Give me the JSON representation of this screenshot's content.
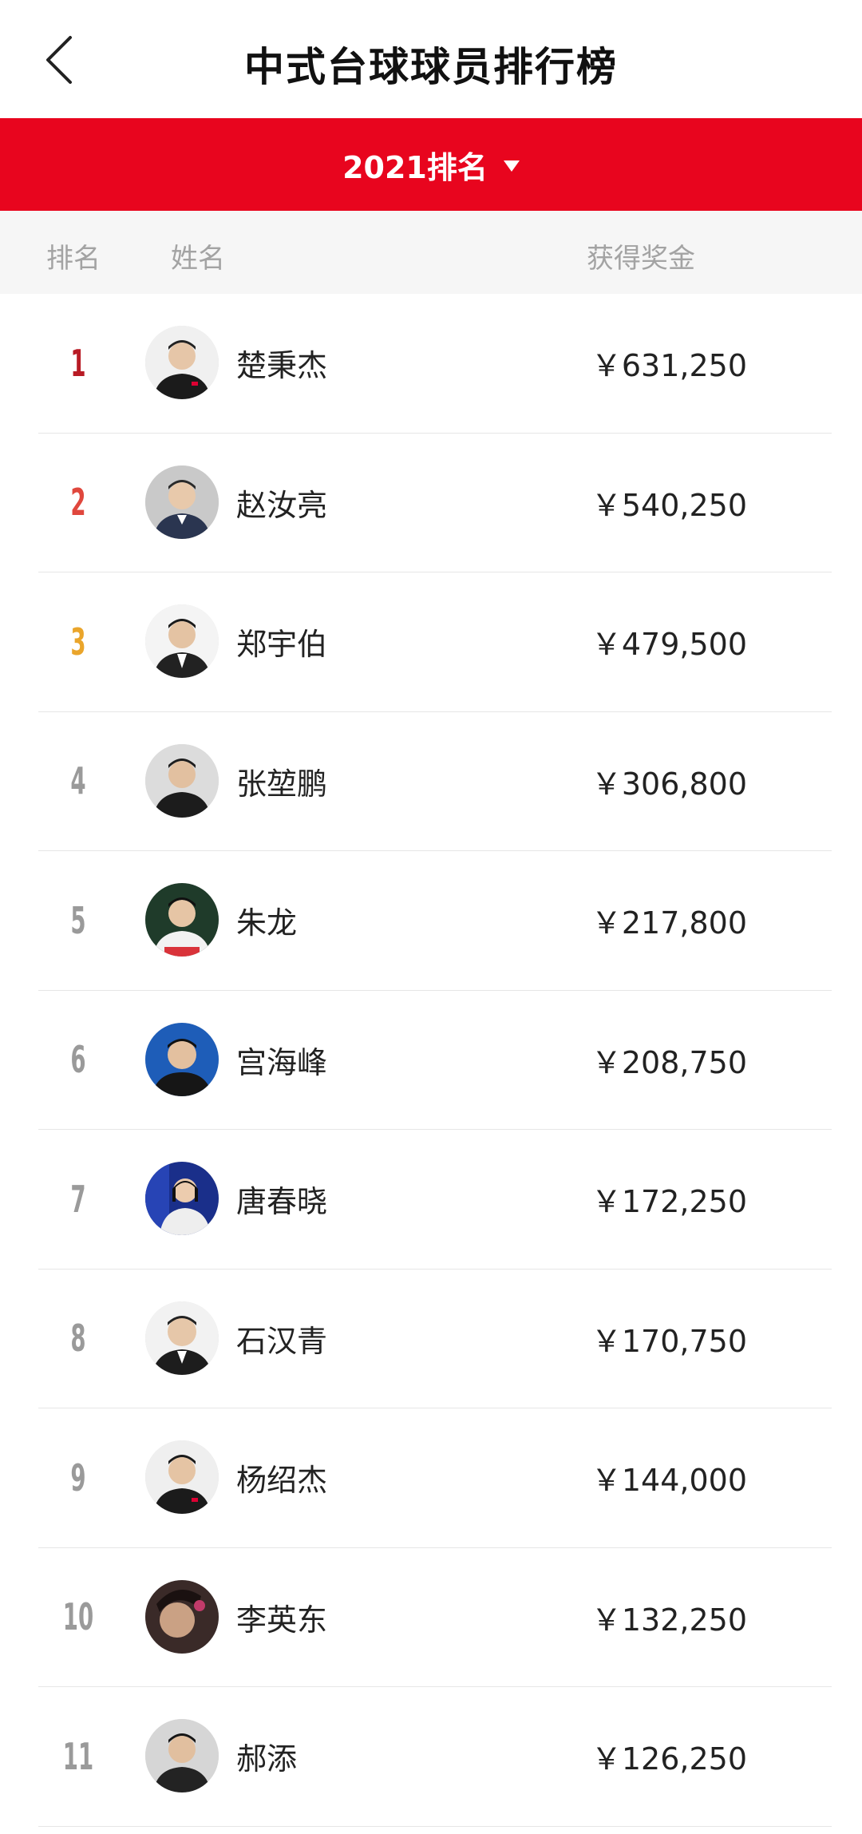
{
  "header": {
    "title": "中式台球球员排行榜"
  },
  "filter": {
    "label": "2021排名"
  },
  "columns": {
    "rank": "排名",
    "name": "姓名",
    "prize": "获得奖金"
  },
  "colors": {
    "accent": "#e8051e",
    "rank1": "#b81b25",
    "rank2": "#e0473d",
    "rank3": "#eaa52b"
  },
  "players": [
    {
      "rank": "1",
      "name": "楚秉杰",
      "prize": "￥631,250"
    },
    {
      "rank": "2",
      "name": "赵汝亮",
      "prize": "￥540,250"
    },
    {
      "rank": "3",
      "name": "郑宇伯",
      "prize": "￥479,500"
    },
    {
      "rank": "4",
      "name": "张堃鹏",
      "prize": "￥306,800"
    },
    {
      "rank": "5",
      "name": "朱龙",
      "prize": "￥217,800"
    },
    {
      "rank": "6",
      "name": "宫海峰",
      "prize": "￥208,750"
    },
    {
      "rank": "7",
      "name": "唐春晓",
      "prize": "￥172,250"
    },
    {
      "rank": "8",
      "name": "石汉青",
      "prize": "￥170,750"
    },
    {
      "rank": "9",
      "name": "杨绍杰",
      "prize": "￥144,000"
    },
    {
      "rank": "10",
      "name": "李英东",
      "prize": "￥132,250"
    },
    {
      "rank": "11",
      "name": "郝添",
      "prize": "￥126,250"
    }
  ]
}
